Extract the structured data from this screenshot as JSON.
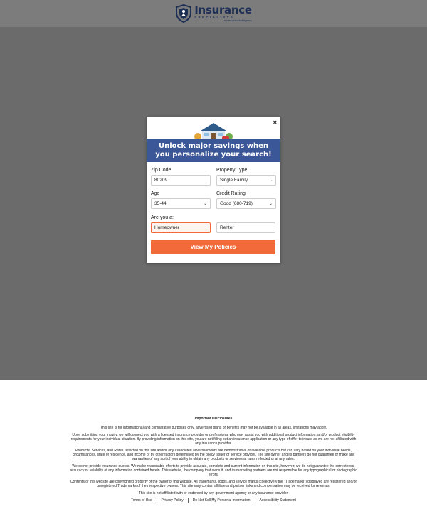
{
  "brand": {
    "title": "Insurance",
    "subtitle": "SPECIALISTS",
    "tagline": "a comparisonlinkAgency"
  },
  "modal": {
    "close_label": "×",
    "headline_line1": "Unlock major savings when",
    "headline_line2": "you personalize your search!",
    "zip": {
      "label": "Zip Code",
      "value": "80209"
    },
    "property_type": {
      "label": "Property Type",
      "value": "Single Family"
    },
    "age": {
      "label": "Age",
      "value": "35-44"
    },
    "credit": {
      "label": "Credit Rating",
      "value": "Good (680-719)"
    },
    "are_you": {
      "label": "Are you a:",
      "options": [
        "Homeowner",
        "Renter"
      ],
      "selected": "Homeowner"
    },
    "cta": "View My Policies"
  },
  "disclosures": {
    "title": "Important Disclosures",
    "p1": "This site is for informational and comparative purposes only, advertised plans or benefits may not be available in all areas, limitations may apply.",
    "p2": "Upon submitting your inquiry, we will connect you with a licensed insurance provider or professional who may assist you with additional product information, and/or product eligibility requirements for your individual situation. By providing information on this site, you are not filling out an insurance application or any type of offer to insure as we are not affiliated with any insurance provider.",
    "p3": "Products, Services, and Rates reflected on this site and/or any associated advertisements are demonstrative of available products but can vary based on your individual needs, circumstances, state of residence, and income or by other factors determined by the policy issuer or service provider. The site owner and its partners do not guarantee or make any warranties of any sort of your ability to obtain any products or services at rates reflected or at any rates.",
    "p4": "We do not provide insurance quotes. We make reasonable efforts to provide accurate, complete and current information on this site, however; we do not guarantee the correctness, accuracy or reliability of any information contained herein. This website, the company that owns it, and its marketing partners are not responsible for any typographical or photographic errors.",
    "p5": "Contents of this website are copyrighted property of the owner of this website. All trademarks, logos, and service marks (collectively the \"Trademarks\") displayed are registered and/or unregistered Trademarks of their respective owners. This site may contain affiliate and partner links and compensation may be received for referrals.",
    "p6": "This site is not affiliated with or endorsed by any government agency or any insurance provider."
  },
  "footer_links": [
    "Terms of Use",
    "Privacy Policy",
    "Do Not Sell My Personal Information",
    "Accessibility Statement"
  ],
  "colors": {
    "banner": "#3b5798",
    "cta": "#f26a3a",
    "overlay": "#6b6b6b",
    "brand_navy": "#1e2f55"
  }
}
